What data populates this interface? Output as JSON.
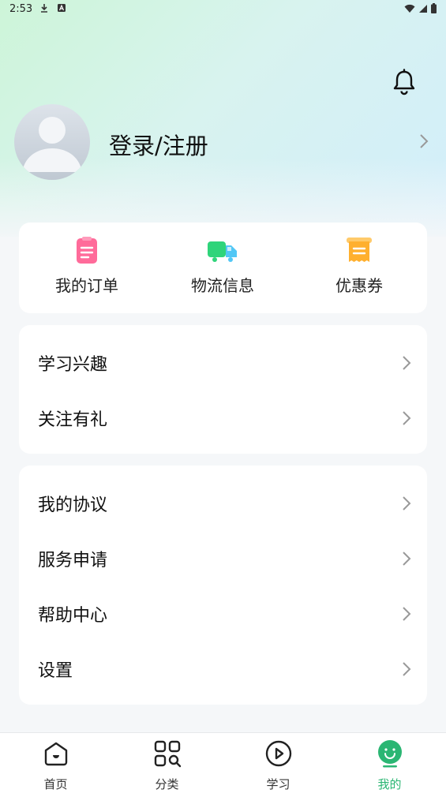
{
  "status_bar": {
    "time": "2:53"
  },
  "header": {
    "notification_icon": "bell-icon"
  },
  "profile": {
    "login_label": "登录/注册"
  },
  "quick_actions": [
    {
      "label": "我的订单",
      "icon": "order-icon",
      "color": "#ff6b9a"
    },
    {
      "label": "物流信息",
      "icon": "truck-icon",
      "color": "#2fd47a"
    },
    {
      "label": "优惠券",
      "icon": "coupon-icon",
      "color": "#ffb02e"
    }
  ],
  "menu_group_1": [
    {
      "label": "学习兴趣"
    },
    {
      "label": "关注有礼"
    }
  ],
  "menu_group_2": [
    {
      "label": "我的协议"
    },
    {
      "label": "服务申请"
    },
    {
      "label": "帮助中心"
    },
    {
      "label": "设置"
    }
  ],
  "tabbar": {
    "active_color": "#2bb673",
    "tabs": [
      {
        "label": "首页",
        "icon": "home-icon"
      },
      {
        "label": "分类",
        "icon": "category-icon"
      },
      {
        "label": "学习",
        "icon": "play-icon"
      },
      {
        "label": "我的",
        "icon": "profile-smile-icon",
        "active": true
      }
    ]
  }
}
